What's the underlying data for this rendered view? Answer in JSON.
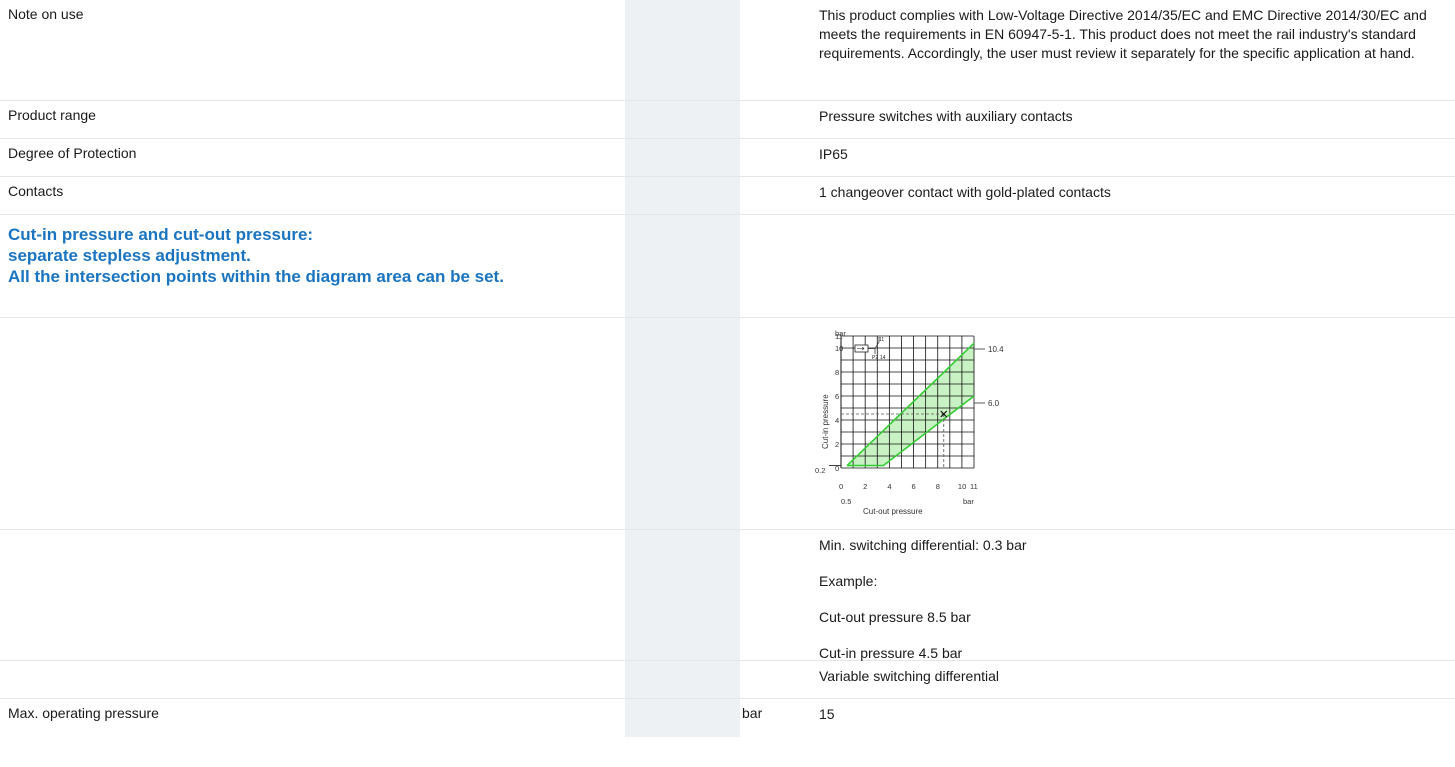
{
  "rows": {
    "note_on_use": {
      "label": "Note on use",
      "value": "This product complies with Low-Voltage Directive 2014/35/EC and EMC Directive 2014/30/EC and meets the requirements in EN 60947-5-1. This product does not meet the rail industry's standard requirements. Accordingly, the user must review it separately for the specific application at hand."
    },
    "product_range": {
      "label": "Product range",
      "value": "Pressure switches with auxiliary contacts"
    },
    "degree_of_protection": {
      "label": "Degree of Protection",
      "value": "IP65"
    },
    "contacts": {
      "label": "Contacts",
      "value": "1 changeover contact with gold-plated contacts"
    },
    "heading": {
      "line1": "Cut-in pressure and cut-out pressure:",
      "line2": "separate stepless adjustment.",
      "line3": "All the intersection points within the diagram area can be set."
    },
    "switching": {
      "min_diff": "Min. switching differential: 0.3 bar",
      "example": "Example:",
      "cut_out": "Cut-out pressure 8.5 bar",
      "cut_in": "Cut-in pressure 4.5 bar"
    },
    "variable": {
      "value": "Variable switching differential"
    },
    "max_pressure": {
      "label": "Max. operating pressure",
      "unit": "bar",
      "value": "15"
    }
  },
  "diagram": {
    "y_unit": "bar",
    "x_unit": "bar",
    "y_axis_label": "Cut-in pressure",
    "x_axis_label": "Cut-out pressure",
    "y_ticks": [
      "11",
      "10",
      "8",
      "6",
      "4",
      "2",
      "0"
    ],
    "x_ticks": [
      "0",
      "2",
      "4",
      "6",
      "8",
      "10",
      "11"
    ],
    "x_min_label": "0.5",
    "y_min_label": "0.2",
    "upper_right_label": "10.4",
    "lower_right_label": "6.0",
    "band_color": "#c9f2c4",
    "line_color": "#33cc33",
    "example_point": {
      "cut_out": 8.5,
      "cut_in": 4.5
    }
  }
}
